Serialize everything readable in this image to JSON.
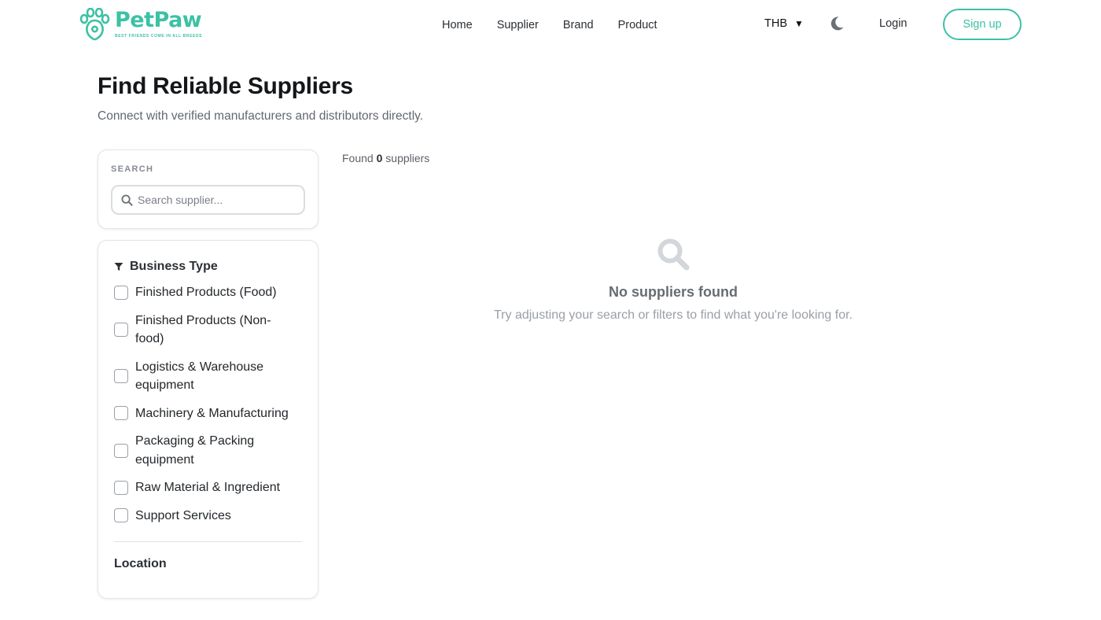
{
  "brand": {
    "name": "PetPaw",
    "tagline": "BEST FRIENDS COME IN ALL BREEDS",
    "color": "#3cc1a4"
  },
  "nav": {
    "items": [
      "Home",
      "Supplier",
      "Brand",
      "Product"
    ]
  },
  "header": {
    "currency": "THB",
    "theme_icon": "moon-icon",
    "login_label": "Login",
    "signup_label": "Sign up"
  },
  "page": {
    "title": "Find Reliable Suppliers",
    "subtitle": "Connect with verified manufacturers and distributors directly."
  },
  "search": {
    "label": "SEARCH",
    "placeholder": "Search supplier...",
    "value": ""
  },
  "filters": {
    "business_type_title": "Business Type",
    "business_types": [
      {
        "label": "Finished Products (Food)",
        "checked": false
      },
      {
        "label": "Finished Products (Non-food)",
        "checked": false
      },
      {
        "label": "Logistics & Warehouse equipment",
        "checked": false
      },
      {
        "label": "Machinery & Manufacturing",
        "checked": false
      },
      {
        "label": "Packaging & Packing equipment",
        "checked": false
      },
      {
        "label": "Raw Material & Ingredient",
        "checked": false
      },
      {
        "label": "Support Services",
        "checked": false
      }
    ],
    "location_title": "Location"
  },
  "results": {
    "found_prefix": "Found",
    "count": "0",
    "found_suffix": "suppliers",
    "empty_title": "No suppliers found",
    "empty_text": "Try adjusting your search or filters to find what you're looking for."
  }
}
